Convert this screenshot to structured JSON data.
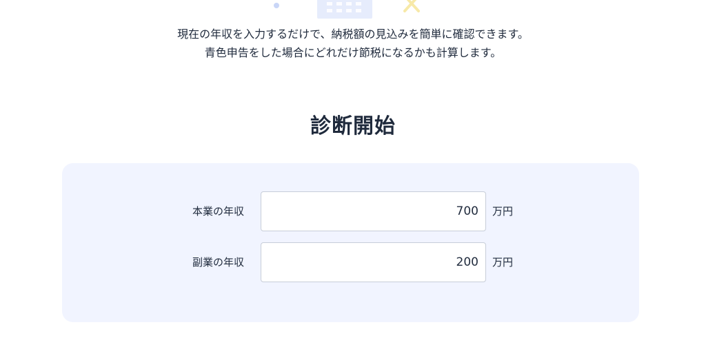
{
  "decor": {
    "dot_icon": "dot-icon",
    "building_icon": "building-icon",
    "cross_icon": "cross-icon",
    "dot_color": "#c9d6f7",
    "building_color": "#e6ecfc",
    "cross_color": "#f7e9a8"
  },
  "intro": {
    "line1": "現在の年収を入力するだけで、納税額の見込みを簡単に確認できます。",
    "line2": "青色申告をした場合にどれだけ節税になるかも計算します。"
  },
  "diagnosis": {
    "title": "診断開始",
    "panel_color": "#f1f4ff",
    "fields": [
      {
        "label": "本業の年収",
        "value": "700",
        "unit": "万円"
      },
      {
        "label": "副業の年収",
        "value": "200",
        "unit": "万円"
      }
    ]
  }
}
